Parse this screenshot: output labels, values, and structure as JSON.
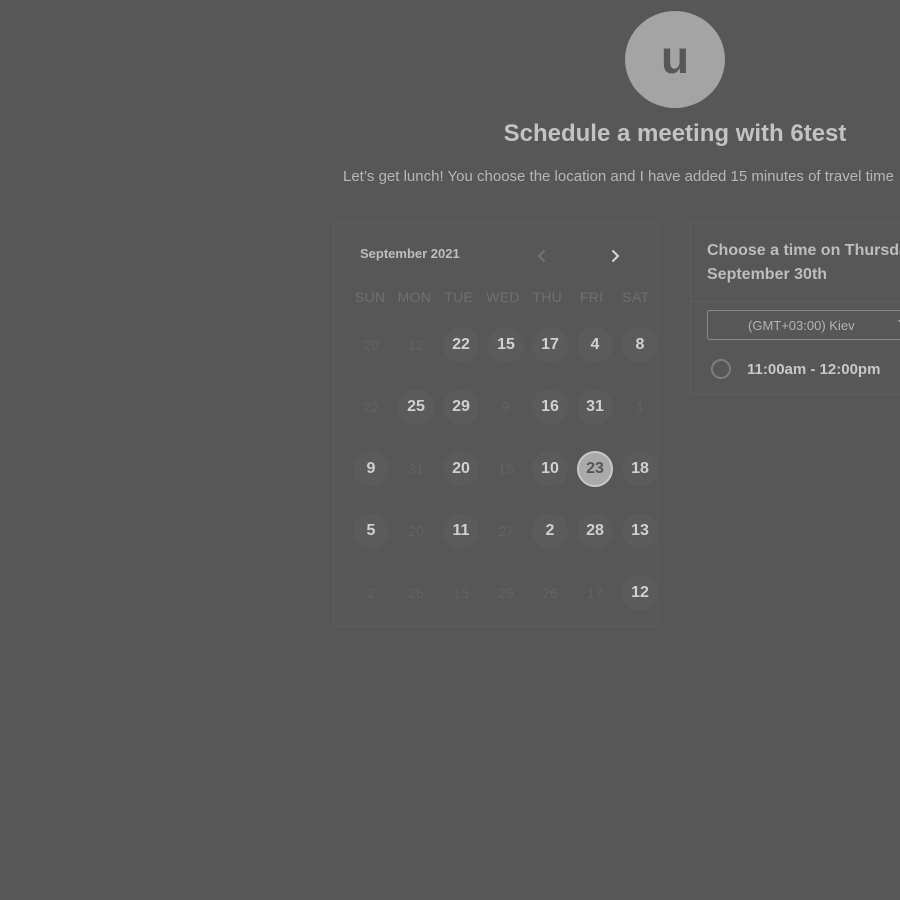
{
  "header": {
    "avatar_initial": "u",
    "title": "Schedule a meeting with 6test",
    "description": "Let’s get lunch! You choose the location and I have added 15 minutes of travel time"
  },
  "calendar": {
    "month_label": "September 2021",
    "prev_icon": "chevron-left-icon",
    "next_icon": "chevron-right-icon",
    "weekdays": [
      "SUN",
      "MON",
      "TUE",
      "WED",
      "THU",
      "FRI",
      "SAT"
    ],
    "weeks": [
      [
        {
          "label": "20",
          "available": false
        },
        {
          "label": "12",
          "available": false
        },
        {
          "label": "22",
          "available": true
        },
        {
          "label": "15",
          "available": true
        },
        {
          "label": "17",
          "available": true
        },
        {
          "label": "4",
          "available": true
        },
        {
          "label": "8",
          "available": true
        }
      ],
      [
        {
          "label": "22",
          "available": false
        },
        {
          "label": "25",
          "available": true
        },
        {
          "label": "29",
          "available": true
        },
        {
          "label": "9",
          "available": false
        },
        {
          "label": "16",
          "available": true
        },
        {
          "label": "31",
          "available": true
        },
        {
          "label": "1",
          "available": false
        }
      ],
      [
        {
          "label": "9",
          "available": true
        },
        {
          "label": "31",
          "available": false
        },
        {
          "label": "20",
          "available": true
        },
        {
          "label": "15",
          "available": false
        },
        {
          "label": "10",
          "available": true
        },
        {
          "label": "23",
          "available": true,
          "selected": true
        },
        {
          "label": "18",
          "available": true
        }
      ],
      [
        {
          "label": "5",
          "available": true
        },
        {
          "label": "20",
          "available": false
        },
        {
          "label": "11",
          "available": true
        },
        {
          "label": "27",
          "available": false
        },
        {
          "label": "2",
          "available": true
        },
        {
          "label": "28",
          "available": true
        },
        {
          "label": "13",
          "available": true
        }
      ],
      [
        {
          "label": "2",
          "available": false
        },
        {
          "label": "25",
          "available": false
        },
        {
          "label": "15",
          "available": false
        },
        {
          "label": "29",
          "available": false
        },
        {
          "label": "26",
          "available": false
        },
        {
          "label": "17",
          "available": false
        },
        {
          "label": "12",
          "available": true
        }
      ]
    ]
  },
  "time_picker": {
    "heading_line1": "Choose a time on Thursday,",
    "heading_line2": "September 30th",
    "timezone": "(GMT+03:00) Kiev",
    "slots": [
      {
        "label": "11:00am - 12:00pm",
        "selected": false
      }
    ]
  },
  "colors": {
    "background": "#575757",
    "selected_day": "#aaaaaa"
  }
}
